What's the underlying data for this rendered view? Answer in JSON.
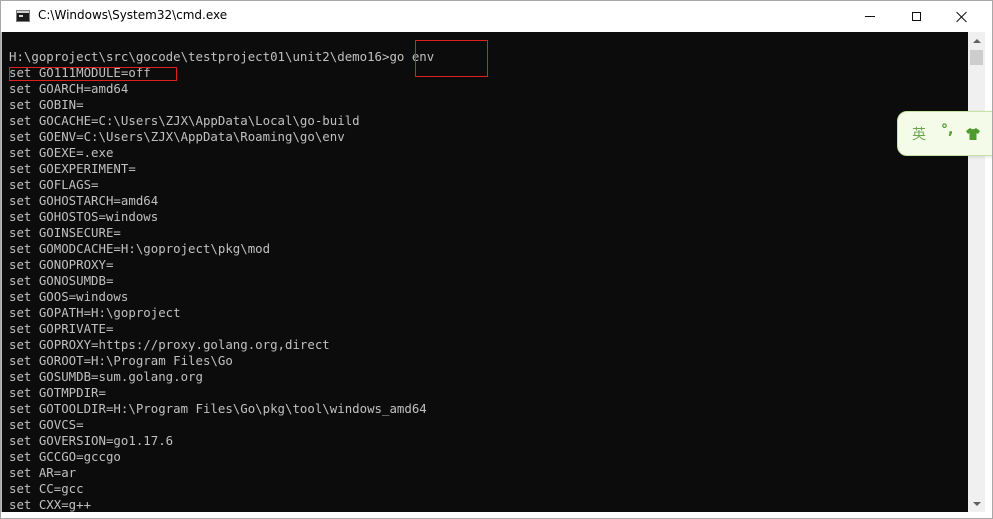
{
  "window": {
    "title": "C:\\Windows\\System32\\cmd.exe",
    "app_icon": "console-icon",
    "controls": {
      "minimize_icon": "minimize-icon",
      "maximize_icon": "maximize-icon",
      "close_icon": "close-icon"
    }
  },
  "console": {
    "prompt": "H:\\goproject\\src\\gocode\\testproject01\\unit2\\demo16>",
    "command": "go env",
    "lines": [
      "set GO111MODULE=off",
      "set GOARCH=amd64",
      "set GOBIN=",
      "set GOCACHE=C:\\Users\\ZJX\\AppData\\Local\\go-build",
      "set GOENV=C:\\Users\\ZJX\\AppData\\Roaming\\go\\env",
      "set GOEXE=.exe",
      "set GOEXPERIMENT=",
      "set GOFLAGS=",
      "set GOHOSTARCH=amd64",
      "set GOHOSTOS=windows",
      "set GOINSECURE=",
      "set GOMODCACHE=H:\\goproject\\pkg\\mod",
      "set GONOPROXY=",
      "set GONOSUMDB=",
      "set GOOS=windows",
      "set GOPATH=H:\\goproject",
      "set GOPRIVATE=",
      "set GOPROXY=https://proxy.golang.org,direct",
      "set GOROOT=H:\\Program Files\\Go",
      "set GOSUMDB=sum.golang.org",
      "set GOTMPDIR=",
      "set GOTOOLDIR=H:\\Program Files\\Go\\pkg\\tool\\windows_amd64",
      "set GOVCS=",
      "set GOVERSION=go1.17.6",
      "set GCCGO=gccgo",
      "set AR=ar",
      "set CC=gcc",
      "set CXX=g++"
    ],
    "colors": {
      "background": "#0c0c0c",
      "text": "#c0c0c0",
      "annotation": "#e02020"
    }
  },
  "ime": {
    "language": "英",
    "punctuation": "°,",
    "skin_icon": "tshirt-icon",
    "accent": "#6aa84f"
  }
}
